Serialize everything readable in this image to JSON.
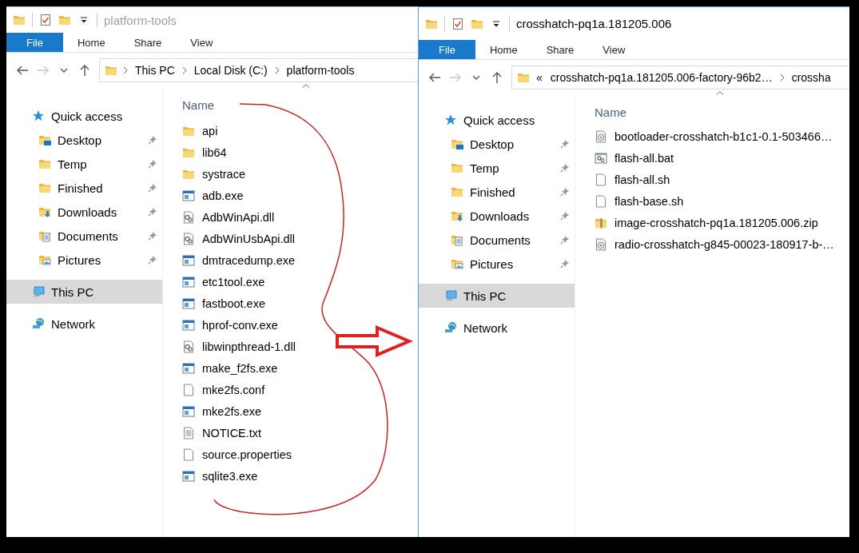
{
  "windows": [
    {
      "active": false,
      "title": "platform-tools",
      "forward_disabled": true,
      "ribbon_tabs": [
        {
          "label": "File",
          "kind": "file"
        },
        {
          "label": "Home",
          "kind": "tab"
        },
        {
          "label": "Share",
          "kind": "tab"
        },
        {
          "label": "View",
          "kind": "tab"
        }
      ],
      "address": {
        "crumbs": [
          "This PC",
          "Local Disk (C:)",
          "platform-tools"
        ]
      },
      "nav": [
        {
          "label": "Quick access",
          "kind": "star",
          "selected": false,
          "children": [
            {
              "label": "Desktop",
              "kind": "desktop",
              "pinned": true,
              "selected": false
            },
            {
              "label": "Temp",
              "kind": "folder",
              "pinned": true,
              "selected": false
            },
            {
              "label": "Finished",
              "kind": "folder",
              "pinned": true,
              "selected": false
            },
            {
              "label": "Downloads",
              "kind": "downloads",
              "pinned": true,
              "selected": false
            },
            {
              "label": "Documents",
              "kind": "documents",
              "pinned": true,
              "selected": false
            },
            {
              "label": "Pictures",
              "kind": "pictures",
              "pinned": true,
              "selected": false
            }
          ]
        },
        {
          "label": "This PC",
          "kind": "pc",
          "selected": true
        },
        {
          "label": "Network",
          "kind": "network",
          "selected": false
        }
      ],
      "column": "Name",
      "files": [
        {
          "name": "api",
          "kind": "folder"
        },
        {
          "name": "lib64",
          "kind": "folder"
        },
        {
          "name": "systrace",
          "kind": "folder"
        },
        {
          "name": "adb.exe",
          "kind": "exe"
        },
        {
          "name": "AdbWinApi.dll",
          "kind": "dll"
        },
        {
          "name": "AdbWinUsbApi.dll",
          "kind": "dll"
        },
        {
          "name": "dmtracedump.exe",
          "kind": "exe"
        },
        {
          "name": "etc1tool.exe",
          "kind": "exe"
        },
        {
          "name": "fastboot.exe",
          "kind": "exe"
        },
        {
          "name": "hprof-conv.exe",
          "kind": "exe"
        },
        {
          "name": "libwinpthread-1.dll",
          "kind": "dll"
        },
        {
          "name": "make_f2fs.exe",
          "kind": "exe"
        },
        {
          "name": "mke2fs.conf",
          "kind": "file"
        },
        {
          "name": "mke2fs.exe",
          "kind": "exe"
        },
        {
          "name": "NOTICE.txt",
          "kind": "text"
        },
        {
          "name": "source.properties",
          "kind": "file"
        },
        {
          "name": "sqlite3.exe",
          "kind": "exe"
        }
      ]
    },
    {
      "active": true,
      "title": "crosshatch-pq1a.181205.006",
      "forward_disabled": true,
      "ribbon_tabs": [
        {
          "label": "File",
          "kind": "file"
        },
        {
          "label": "Home",
          "kind": "tab"
        },
        {
          "label": "Share",
          "kind": "tab"
        },
        {
          "label": "View",
          "kind": "tab"
        }
      ],
      "address": {
        "overflow": "«",
        "crumbs": [
          "crosshatch-pq1a.181205.006-factory-96b2…",
          "crossha"
        ]
      },
      "nav": [
        {
          "label": "Quick access",
          "kind": "star",
          "selected": false,
          "children": [
            {
              "label": "Desktop",
              "kind": "desktop",
              "pinned": true,
              "selected": false
            },
            {
              "label": "Temp",
              "kind": "folder",
              "pinned": true,
              "selected": false
            },
            {
              "label": "Finished",
              "kind": "folder",
              "pinned": true,
              "selected": false
            },
            {
              "label": "Downloads",
              "kind": "downloads",
              "pinned": true,
              "selected": false
            },
            {
              "label": "Documents",
              "kind": "documents",
              "pinned": true,
              "selected": false
            },
            {
              "label": "Pictures",
              "kind": "pictures",
              "pinned": true,
              "selected": false
            }
          ]
        },
        {
          "label": "This PC",
          "kind": "pc",
          "selected": true
        },
        {
          "label": "Network",
          "kind": "network",
          "selected": false
        }
      ],
      "column": "Name",
      "files": [
        {
          "name": "bootloader-crosshatch-b1c1-0.1-503466…",
          "kind": "disc"
        },
        {
          "name": "flash-all.bat",
          "kind": "bat"
        },
        {
          "name": "flash-all.sh",
          "kind": "file"
        },
        {
          "name": "flash-base.sh",
          "kind": "file"
        },
        {
          "name": "image-crosshatch-pq1a.181205.006.zip",
          "kind": "zip"
        },
        {
          "name": "radio-crosshatch-g845-00023-180917-b-…",
          "kind": "disc"
        }
      ]
    }
  ]
}
